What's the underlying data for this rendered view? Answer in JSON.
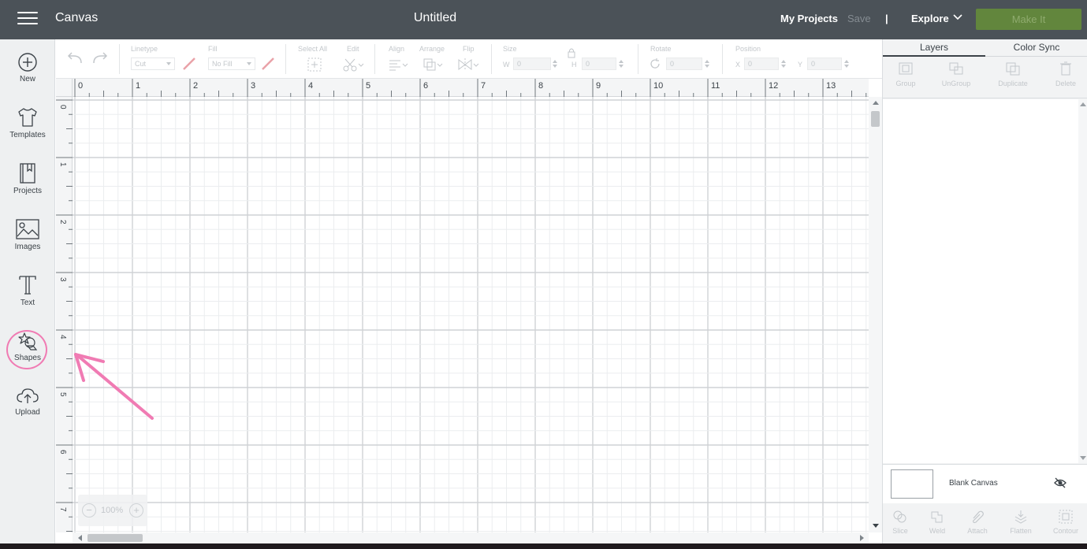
{
  "header": {
    "app_title": "Canvas",
    "doc_title": "Untitled",
    "my_projects": "My Projects",
    "save": "Save",
    "separator": "|",
    "explore": "Explore",
    "make_it": "Make It",
    "bg_color": "#4b5258",
    "make_it_color": "#62863d"
  },
  "sidebar": {
    "items": [
      {
        "label": "New",
        "icon": "plus-circle-icon"
      },
      {
        "label": "Templates",
        "icon": "tshirt-icon"
      },
      {
        "label": "Projects",
        "icon": "bookmark-book-icon"
      },
      {
        "label": "Images",
        "icon": "image-icon"
      },
      {
        "label": "Text",
        "icon": "text-t-icon"
      },
      {
        "label": "Shapes",
        "icon": "shapes-icon"
      },
      {
        "label": "Upload",
        "icon": "cloud-upload-icon"
      }
    ],
    "highlight_color": "#f07bb3"
  },
  "toolbar": {
    "linetype_label": "Linetype",
    "linetype_value": "Cut",
    "fill_label": "Fill",
    "fill_value": "No Fill",
    "select_all_label": "Select All",
    "edit_label": "Edit",
    "align_label": "Align",
    "arrange_label": "Arrange",
    "flip_label": "Flip",
    "size_label": "Size",
    "size_w_label": "W",
    "size_w_value": "0",
    "size_h_label": "H",
    "size_h_value": "0",
    "rotate_label": "Rotate",
    "rotate_value": "0",
    "position_label": "Position",
    "pos_x_label": "X",
    "pos_x_value": "0",
    "pos_y_label": "Y",
    "pos_y_value": "0"
  },
  "canvas": {
    "ruler_top": [
      "0",
      "1",
      "2",
      "3",
      "4",
      "5",
      "6",
      "7",
      "8",
      "9",
      "10",
      "11",
      "12",
      "13"
    ],
    "ruler_left": [
      "0",
      "1",
      "2",
      "3",
      "4",
      "5",
      "6",
      "7"
    ],
    "zoom": "100%",
    "annotation_color": "#f07bb3"
  },
  "panel": {
    "tab_layers": "Layers",
    "tab_color_sync": "Color Sync",
    "actions": [
      "Group",
      "UnGroup",
      "Duplicate",
      "Delete"
    ],
    "blank_canvas": "Blank Canvas",
    "bottom_actions": [
      "Slice",
      "Weld",
      "Attach",
      "Flatten",
      "Contour"
    ]
  }
}
